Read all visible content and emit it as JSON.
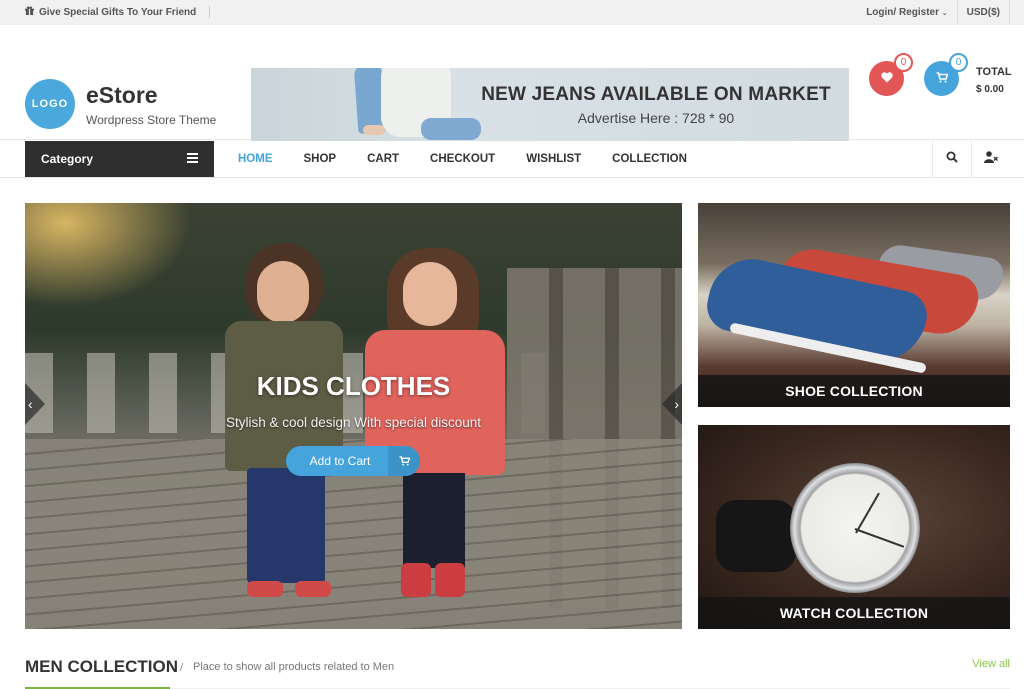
{
  "topbar": {
    "promo_text": "Give Special Gifts To Your Friend",
    "promo_icon": "gift-icon",
    "login_label": "Login/ Register",
    "login_dropdown_icon": "chevron-down-icon",
    "currency_label": "USD($)"
  },
  "header": {
    "logo_text": "LOGO",
    "site_title": "eStore",
    "tagline": "Wordpress Store Theme",
    "ad": {
      "headline": "NEW JEANS AVAILABLE ON MARKET",
      "subtext": "Advertise Here : 728 * 90"
    },
    "wishlist": {
      "icon": "heart-icon",
      "count": "0",
      "color": "#e25656"
    },
    "cart": {
      "icon": "cart-icon",
      "count": "0",
      "color": "#45a4dc"
    },
    "total_label": "TOTAL",
    "total_value": "$ 0.00"
  },
  "nav": {
    "category_label": "Category",
    "category_icon": "hamburger-icon",
    "items": [
      {
        "label": "HOME",
        "active": true
      },
      {
        "label": "SHOP",
        "active": false
      },
      {
        "label": "CART",
        "active": false
      },
      {
        "label": "CHECKOUT",
        "active": false
      },
      {
        "label": "WISHLIST",
        "active": false
      },
      {
        "label": "COLLECTION",
        "active": false
      }
    ],
    "search_icon": "search-icon",
    "user_icon": "user-icon",
    "accent_color": "#45a4dc"
  },
  "slider": {
    "title": "KIDS CLOTHES",
    "subtitle": "Stylish & cool design With special discount",
    "button_label": "Add to Cart",
    "button_icon": "cart-icon",
    "prev_label": "‹",
    "next_label": "›"
  },
  "promos": [
    {
      "caption": "SHOE COLLECTION"
    },
    {
      "caption": "WATCH COLLECTION"
    }
  ],
  "section": {
    "title": "MEN COLLECTION",
    "separator": "/",
    "description": "Place to show all products related to Men",
    "view_all": "View all",
    "accent_color": "#7cb342"
  }
}
